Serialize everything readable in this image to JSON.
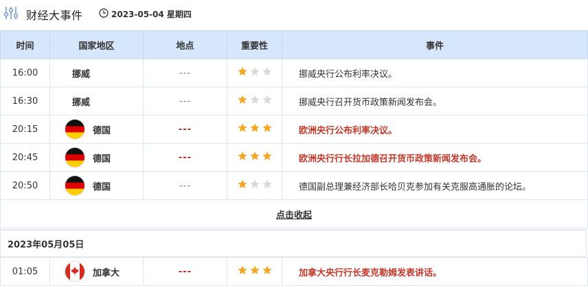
{
  "header": {
    "title": "财经大事件",
    "date": "2023-05-04 星期四"
  },
  "columns": [
    "时间",
    "国家地区",
    "地点",
    "重要性",
    "事件"
  ],
  "events": [
    {
      "time": "16:00",
      "region": "挪威",
      "flag": "none",
      "location": "---",
      "stars": 1,
      "event": "挪威央行公布利率决议。",
      "hot": false
    },
    {
      "time": "16:30",
      "region": "挪威",
      "flag": "none",
      "location": "---",
      "stars": 1,
      "event": "挪威央行召开货币政策新闻发布会。",
      "hot": false
    },
    {
      "time": "20:15",
      "region": "德国",
      "flag": "de",
      "location": "---",
      "stars": 3,
      "event": "欧洲央行公布利率决议。",
      "hot": true
    },
    {
      "time": "20:45",
      "region": "德国",
      "flag": "de",
      "location": "---",
      "stars": 3,
      "event": "欧洲央行行长拉加德召开货币政策新闻发布会。",
      "hot": true
    },
    {
      "time": "20:50",
      "region": "德国",
      "flag": "de",
      "location": "---",
      "stars": 1,
      "event": "德国副总理兼经济部长哈贝克参加有关克服高通胀的论坛。",
      "hot": false
    }
  ],
  "collapse_label": "点击收起",
  "next_day": {
    "date": "2023年05月05日",
    "events": [
      {
        "time": "01:05",
        "region": "加拿大",
        "flag": "ca",
        "location": "---",
        "stars": 3,
        "event": "加拿大央行行长麦克勒姆发表讲话。",
        "hot": true
      }
    ]
  },
  "colors": {
    "header_bg": "#d6e6fb",
    "star_on": "#f5a623",
    "star_off": "#d9d9d9",
    "hot_text": "#c0392b"
  }
}
